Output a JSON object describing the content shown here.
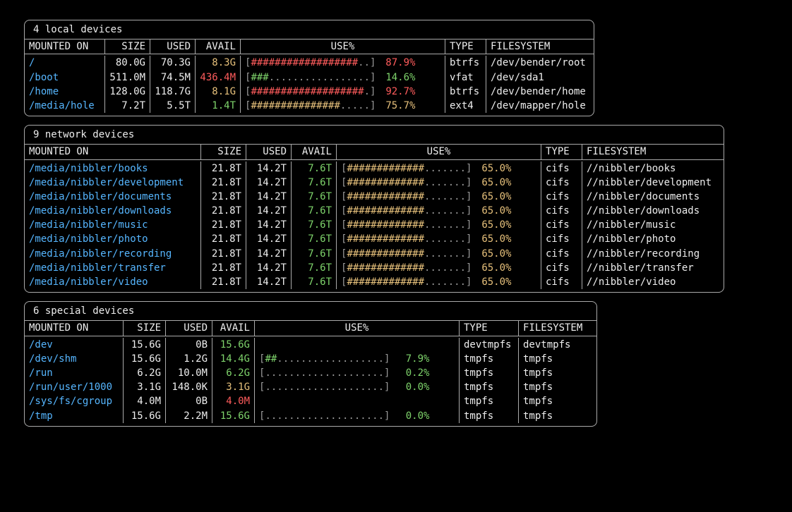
{
  "barWidth": 20,
  "headers": {
    "mount": "MOUNTED ON",
    "size": "SIZE",
    "used": "USED",
    "avail": "AVAIL",
    "usep": "USE%",
    "type": "TYPE",
    "fs": "FILESYSTEM"
  },
  "sections": [
    {
      "title": "4 local devices",
      "widths": {
        "mount": 114,
        "size": 64,
        "used": 64,
        "avail": 64,
        "usep": 290,
        "type": 58,
        "fs": 152
      },
      "rows": [
        {
          "mount": "/",
          "size": "80.0G",
          "used": "70.3G",
          "avail": "8.3G",
          "availClr": "c-pale",
          "pct": 87.9,
          "barClr": "c-red",
          "type": "btrfs",
          "fs": "/dev/bender/root"
        },
        {
          "mount": "/boot",
          "size": "511.0M",
          "used": "74.5M",
          "avail": "436.4M",
          "availClr": "c-red",
          "pct": 14.6,
          "barClr": "c-green",
          "type": "vfat",
          "fs": "/dev/sda1"
        },
        {
          "mount": "/home",
          "size": "128.0G",
          "used": "118.7G",
          "avail": "8.1G",
          "availClr": "c-pale",
          "pct": 92.7,
          "barClr": "c-red",
          "type": "btrfs",
          "fs": "/dev/bender/home"
        },
        {
          "mount": "/media/hole",
          "size": "7.2T",
          "used": "5.5T",
          "avail": "1.4T",
          "availClr": "c-green",
          "pct": 75.7,
          "barClr": "c-pale",
          "type": "ext4",
          "fs": "/dev/mapper/hole"
        }
      ]
    },
    {
      "title": "9 network devices",
      "widths": {
        "mount": 250,
        "size": 64,
        "used": 64,
        "avail": 64,
        "usep": 290,
        "type": 58,
        "fs": 200
      },
      "rows": [
        {
          "mount": "/media/nibbler/books",
          "size": "21.8T",
          "used": "14.2T",
          "avail": "7.6T",
          "availClr": "c-green",
          "pct": 65.0,
          "barClr": "c-pale",
          "type": "cifs",
          "fs": "//nibbler/books"
        },
        {
          "mount": "/media/nibbler/development",
          "size": "21.8T",
          "used": "14.2T",
          "avail": "7.6T",
          "availClr": "c-green",
          "pct": 65.0,
          "barClr": "c-pale",
          "type": "cifs",
          "fs": "//nibbler/development"
        },
        {
          "mount": "/media/nibbler/documents",
          "size": "21.8T",
          "used": "14.2T",
          "avail": "7.6T",
          "availClr": "c-green",
          "pct": 65.0,
          "barClr": "c-pale",
          "type": "cifs",
          "fs": "//nibbler/documents"
        },
        {
          "mount": "/media/nibbler/downloads",
          "size": "21.8T",
          "used": "14.2T",
          "avail": "7.6T",
          "availClr": "c-green",
          "pct": 65.0,
          "barClr": "c-pale",
          "type": "cifs",
          "fs": "//nibbler/downloads"
        },
        {
          "mount": "/media/nibbler/music",
          "size": "21.8T",
          "used": "14.2T",
          "avail": "7.6T",
          "availClr": "c-green",
          "pct": 65.0,
          "barClr": "c-pale",
          "type": "cifs",
          "fs": "//nibbler/music"
        },
        {
          "mount": "/media/nibbler/photo",
          "size": "21.8T",
          "used": "14.2T",
          "avail": "7.6T",
          "availClr": "c-green",
          "pct": 65.0,
          "barClr": "c-pale",
          "type": "cifs",
          "fs": "//nibbler/photo"
        },
        {
          "mount": "/media/nibbler/recording",
          "size": "21.8T",
          "used": "14.2T",
          "avail": "7.6T",
          "availClr": "c-green",
          "pct": 65.0,
          "barClr": "c-pale",
          "type": "cifs",
          "fs": "//nibbler/recording"
        },
        {
          "mount": "/media/nibbler/transfer",
          "size": "21.8T",
          "used": "14.2T",
          "avail": "7.6T",
          "availClr": "c-green",
          "pct": 65.0,
          "barClr": "c-pale",
          "type": "cifs",
          "fs": "//nibbler/transfer"
        },
        {
          "mount": "/media/nibbler/video",
          "size": "21.8T",
          "used": "14.2T",
          "avail": "7.6T",
          "availClr": "c-green",
          "pct": 65.0,
          "barClr": "c-pale",
          "type": "cifs",
          "fs": "//nibbler/video"
        }
      ]
    },
    {
      "title": "6 special devices",
      "widths": {
        "mount": 140,
        "size": 60,
        "used": 66,
        "avail": 60,
        "usep": 290,
        "type": 84,
        "fs": 110
      },
      "rows": [
        {
          "mount": "/dev",
          "size": "15.6G",
          "used": "0B",
          "avail": "15.6G",
          "availClr": "c-green",
          "pct": null,
          "barClr": "",
          "type": "devtmpfs",
          "fs": "devtmpfs"
        },
        {
          "mount": "/dev/shm",
          "size": "15.6G",
          "used": "1.2G",
          "avail": "14.4G",
          "availClr": "c-green",
          "pct": 7.9,
          "barClr": "c-green",
          "type": "tmpfs",
          "fs": "tmpfs"
        },
        {
          "mount": "/run",
          "size": "6.2G",
          "used": "10.0M",
          "avail": "6.2G",
          "availClr": "c-green",
          "pct": 0.2,
          "barClr": "c-green",
          "type": "tmpfs",
          "fs": "tmpfs"
        },
        {
          "mount": "/run/user/1000",
          "size": "3.1G",
          "used": "148.0K",
          "avail": "3.1G",
          "availClr": "c-pale",
          "pct": 0.0,
          "barClr": "c-green",
          "type": "tmpfs",
          "fs": "tmpfs"
        },
        {
          "mount": "/sys/fs/cgroup",
          "size": "4.0M",
          "used": "0B",
          "avail": "4.0M",
          "availClr": "c-red",
          "pct": null,
          "barClr": "",
          "type": "tmpfs",
          "fs": "tmpfs"
        },
        {
          "mount": "/tmp",
          "size": "15.6G",
          "used": "2.2M",
          "avail": "15.6G",
          "availClr": "c-green",
          "pct": 0.0,
          "barClr": "c-green",
          "type": "tmpfs",
          "fs": "tmpfs"
        }
      ]
    }
  ]
}
